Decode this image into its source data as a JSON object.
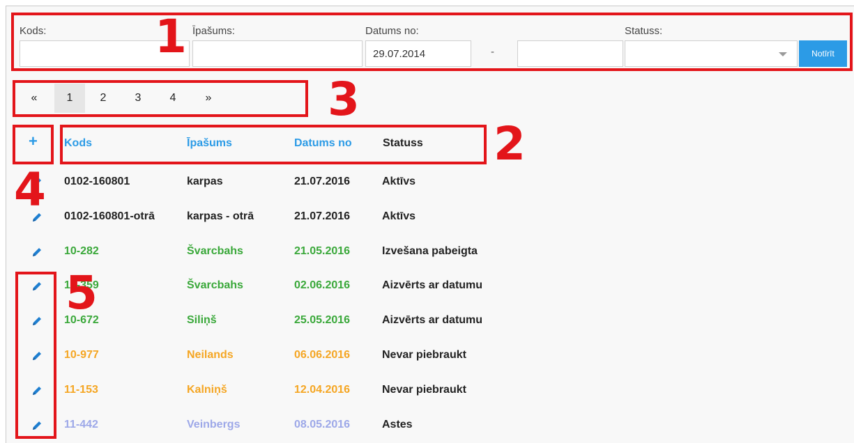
{
  "filters": {
    "kods_label": "Kods:",
    "kods_value": "",
    "ipasums_label": "Īpašums:",
    "ipasums_value": "",
    "datums_label": "Datums no:",
    "datums_from": "29.07.2014",
    "range_separator": "-",
    "datums_to": "",
    "statuss_label": "Statuss:",
    "statuss_value": "",
    "clear_button": "Notīrīt"
  },
  "pagination": {
    "prev": "«",
    "pages": [
      "1",
      "2",
      "3",
      "4"
    ],
    "current": "1",
    "next": "»"
  },
  "table": {
    "add_icon": "+",
    "headers": [
      "Kods",
      "Īpašums",
      "Datums no",
      "Statuss"
    ],
    "rows": [
      {
        "kods": "0102-160801",
        "ipasums": "karpas",
        "datums": "21.07.2016",
        "statuss": "Aktīvs",
        "color": "#222222"
      },
      {
        "kods": "0102-160801-otrā",
        "ipasums": "karpas - otrā",
        "datums": "21.07.2016",
        "statuss": "Aktīvs",
        "color": "#222222"
      },
      {
        "kods": "10-282",
        "ipasums": "Švarcbahs",
        "datums": "21.05.2016",
        "statuss": "Izvešana pabeigta",
        "color": "#3aa83a"
      },
      {
        "kods": "10-359",
        "ipasums": "Švarcbahs",
        "datums": "02.06.2016",
        "statuss": "Aizvērts ar datumu",
        "color": "#3aa83a"
      },
      {
        "kods": "10-672",
        "ipasums": "Siliņš",
        "datums": "25.05.2016",
        "statuss": "Aizvērts ar datumu",
        "color": "#3aa83a"
      },
      {
        "kods": "10-977",
        "ipasums": "Neilands",
        "datums": "06.06.2016",
        "statuss": "Nevar piebraukt",
        "color": "#f5a623"
      },
      {
        "kods": "11-153",
        "ipasums": "Kalniņš",
        "datums": "12.04.2016",
        "statuss": "Nevar piebraukt",
        "color": "#f5a623"
      },
      {
        "kods": "11-442",
        "ipasums": "Veinbergs",
        "datums": "08.05.2016",
        "statuss": "Astes",
        "color": "#9da8e8"
      }
    ]
  },
  "annotations": {
    "numbers": [
      "1",
      "2",
      "3",
      "4",
      "5"
    ],
    "color": "#e3151a"
  },
  "colors": {
    "accent": "#2c9be6",
    "status_text": "#222222"
  }
}
